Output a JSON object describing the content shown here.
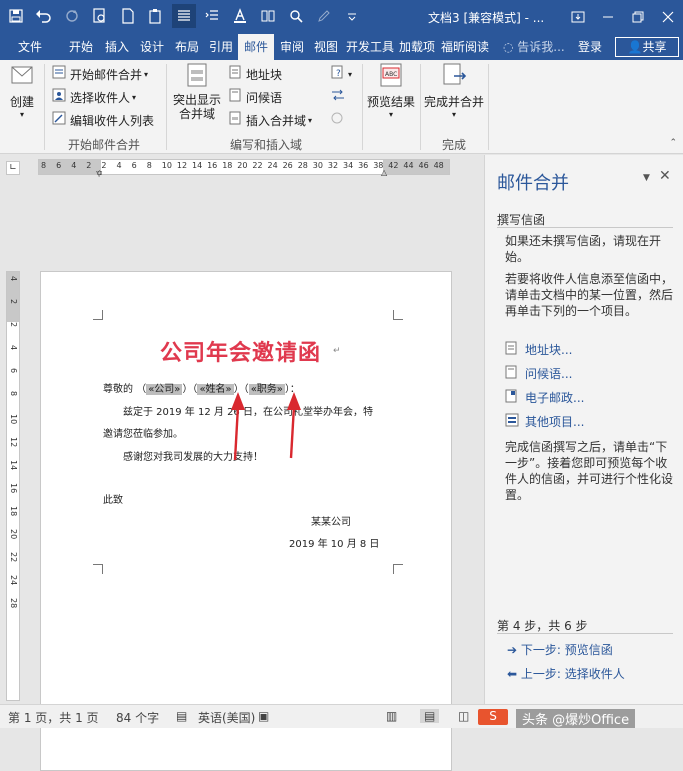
{
  "window": {
    "doc_title": "文档3 [兼容模式] - ..."
  },
  "tabs": [
    "文件",
    "开始",
    "插入",
    "设计",
    "布局",
    "引用",
    "邮件",
    "审阅",
    "视图",
    "开发工具",
    "加载项",
    "福昕阅读"
  ],
  "active_tab": "邮件",
  "tell_me": "告诉我...",
  "login": "登录",
  "share": "共享",
  "ribbon": {
    "create": "创建",
    "start_merge": "开始邮件合并",
    "select_recipients": "选择收件人",
    "edit_recipients": "编辑收件人列表",
    "group_start": "开始邮件合并",
    "highlight_fields": "突出显示合并域",
    "address_block": "地址块",
    "greeting_line": "问候语",
    "insert_merge_field": "插入合并域",
    "group_write": "编写和插入域",
    "preview_results": "预览结果",
    "finish_merge": "完成并合并",
    "group_finish": "完成",
    "abc": "ABC"
  },
  "ruler_h": [
    "8",
    "6",
    "4",
    "2",
    "2",
    "4",
    "6",
    "8",
    "10",
    "12",
    "14",
    "16",
    "18",
    "20",
    "22",
    "24",
    "26",
    "28",
    "30",
    "32",
    "34",
    "36",
    "38",
    "42",
    "44",
    "46",
    "48"
  ],
  "ruler_v": [
    "4",
    "2",
    "2",
    "4",
    "6",
    "8",
    "10",
    "12",
    "14",
    "16",
    "18",
    "20",
    "22",
    "24",
    "28"
  ],
  "document": {
    "title": "公司年会邀请函",
    "salutation_prefix": "尊敬的",
    "field_company": "«公司»",
    "field_name": "«姓名»",
    "field_position": "«职务»",
    "para1_line1": "兹定于 2019 年 12 月 26 日，在公司礼堂举办年会，特",
    "para1_line2": "邀请您莅临参加。",
    "para2": "感谢您对我司发展的大力支持！",
    "closing": "此致",
    "company": "某某公司",
    "date": "2019 年 10 月 8 日"
  },
  "taskpane": {
    "title": "邮件合并",
    "heading": "撰写信函",
    "p1": "如果还未撰写信函，请现在开始。",
    "p2": "若要将收件人信息添至信函中，请单击文档中的某一位置，然后再单击下列的一个项目。",
    "links": [
      "地址块...",
      "问候语...",
      "电子邮政...",
      "其他项目..."
    ],
    "p3": "完成信函撰写之后，请单击“下一步”。接着您即可预览每个收件人的信函，并可进行个性化设置。",
    "step": "第 4 步，共 6 步",
    "next": "下一步: 预览信函",
    "prev": "上一步: 选择收件人"
  },
  "status": {
    "page": "第 1 页，共 1 页",
    "words": "84 个字",
    "lang": "英语(美国)",
    "watermark": "头条 @爆炒Office"
  },
  "colors": {
    "brand": "#2b579a",
    "title_red": "#e0394e",
    "arrow_red": "#d9282f"
  }
}
